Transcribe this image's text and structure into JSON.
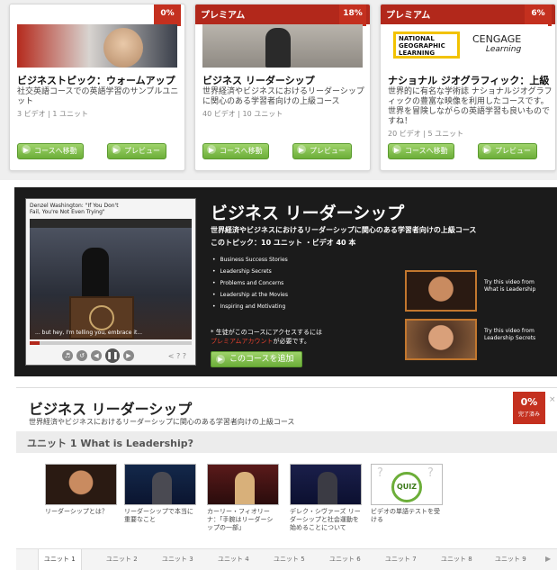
{
  "cards": [
    {
      "premium_label": "",
      "percent": "0%",
      "title": "ビジネストピック：ウォームアップ",
      "description": "社交英語コースでの英語学習のサンプルユニット",
      "meta": "3 ビデオ | 1 ユニット",
      "go_button": "コースへ移動",
      "preview_button": "プレビュー"
    },
    {
      "premium_label": "プレミアム",
      "percent": "18%",
      "title": "ビジネス リーダーシップ",
      "description": "世界経済やビジネスにおけるリーダーシップに関心のある学習者向けの上級コース",
      "meta": "40 ビデオ | 10 ユニット",
      "go_button": "コースへ移動",
      "preview_button": "プレビュー"
    },
    {
      "premium_label": "プレミアム",
      "percent": "6%",
      "title": "ナショナル ジオグラフィック：上級",
      "description": "世界的に有名な学術誌 ナショナルジオグラフィックの豊富な映像を利用したコースです。世界を冒険しながらの英語学習も良いものですね！",
      "meta": "20 ビデオ | 5 ユニット",
      "go_button": "コースへ移動",
      "preview_button": "プレビュー",
      "logo_lines": [
        "NATIONAL",
        "GEOGRAPHIC",
        "LEARNING"
      ],
      "partner_logo": "CENGAGE",
      "partner_logo_sub": "Learning"
    }
  ],
  "promo": {
    "video": {
      "title": "Denzel Washington: \"If You Don't Fail, You're Not Even Trying\"",
      "caption": "... but hey, I'm telling you, embrace it...",
      "progress": 0.06
    },
    "title": "ビジネス リーダーシップ",
    "subtitle": "世界経済やビジネスにおけるリーダーシップに関心のある学習者向けの上級コース",
    "topic_count": "このトピック：10 ユニット ・ビデオ 40 本",
    "topics": [
      "Business Success Stories",
      "Leadership Secrets",
      "Problems and Concerns",
      "Leadership at the Movies",
      "Inspiring and Motivating"
    ],
    "access_note_1": "* 生徒がこのコースにアクセスするには",
    "access_link": "プレミアムアカウント",
    "access_note_2": "が必要です。",
    "add_button": "このコースを追加",
    "try_items": [
      {
        "text": "Try this video from What is Leadership"
      },
      {
        "text": "Try this video from Leadership Secrets"
      }
    ]
  },
  "detail": {
    "title": "ビジネス リーダーシップ",
    "subtitle": "世界経済やビジネスにおけるリーダーシップに関心のある学習者向けの上級コース",
    "badge_percent": "0%",
    "badge_label": "完了済み",
    "close": "×",
    "unit_heading": "ユニット 1 What is Leadership?",
    "videos": [
      {
        "caption": "リーダーシップとは？"
      },
      {
        "caption": "リーダーシップで本当に重要なこと"
      },
      {
        "caption": "カーリー・フィオリーナ：「手腕はリーダーシップの一部」"
      },
      {
        "caption": "デレク・シヴァーズ リーダーシップと社会運動を始めることについて"
      },
      {
        "caption": "ビデオの単語テストを受ける",
        "quiz_label": "QUIZ"
      }
    ],
    "tabs": [
      "ユニット 1",
      "ユニット 2",
      "ユニット 3",
      "ユニット 4",
      "ユニット 5",
      "ユニット 6",
      "ユニット 7",
      "ユニット 8",
      "ユニット 9"
    ],
    "active_tab": 0
  },
  "colors": {
    "brand_red": "#c4301f",
    "action_green": "#6cae39",
    "promo_bg": "#1b1b1b"
  }
}
